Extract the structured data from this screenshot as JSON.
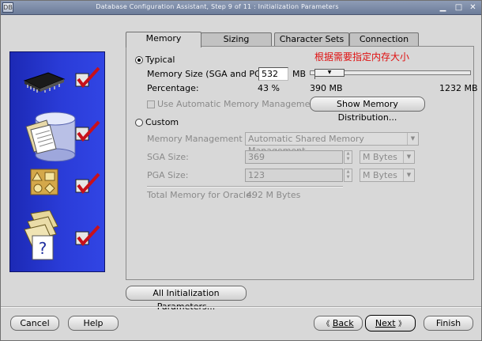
{
  "window": {
    "title": "Database Configuration Assistant, Step 9 of 11 : Initialization Parameters",
    "icon_label": "DB"
  },
  "tabs": [
    {
      "label": "Memory",
      "active": true
    },
    {
      "label": "Sizing",
      "active": false
    },
    {
      "label": "Character Sets",
      "active": false
    },
    {
      "label": "Connection Mode",
      "active": false
    }
  ],
  "typical": {
    "label": "Typical",
    "selected": true,
    "memory_size_label": "Memory Size (SGA and PGA):",
    "memory_size_value": "532",
    "memory_size_unit": "MB",
    "percentage_label": "Percentage:",
    "percentage_value": "43 %",
    "slider_min": "390 MB",
    "slider_max": "1232 MB",
    "slider_fraction": 0.0,
    "amm_label": "Use Automatic Memory Management",
    "show_dist_button": "Show Memory Distribution..."
  },
  "annotation": {
    "text": "根据需要指定内存大小",
    "color": "#e01010"
  },
  "custom": {
    "label": "Custom",
    "selected": false,
    "memory_mgmt_label": "Memory Management",
    "memory_mgmt_value": "Automatic Shared Memory Management",
    "sga_label": "SGA Size:",
    "sga_value": "369",
    "sga_unit": "M Bytes",
    "pga_label": "PGA Size:",
    "pga_value": "123",
    "pga_unit": "M Bytes",
    "total_label": "Total Memory for Oracle:",
    "total_value": "492 M Bytes"
  },
  "all_params_button": "All Initialization Parameters...",
  "footer": {
    "cancel": "Cancel",
    "help": "Help",
    "back": "Back",
    "next": "Next",
    "finish": "Finish"
  },
  "side_panel": {
    "colors": {
      "bg": "#2a3cd8",
      "check": "#c8101a"
    }
  }
}
